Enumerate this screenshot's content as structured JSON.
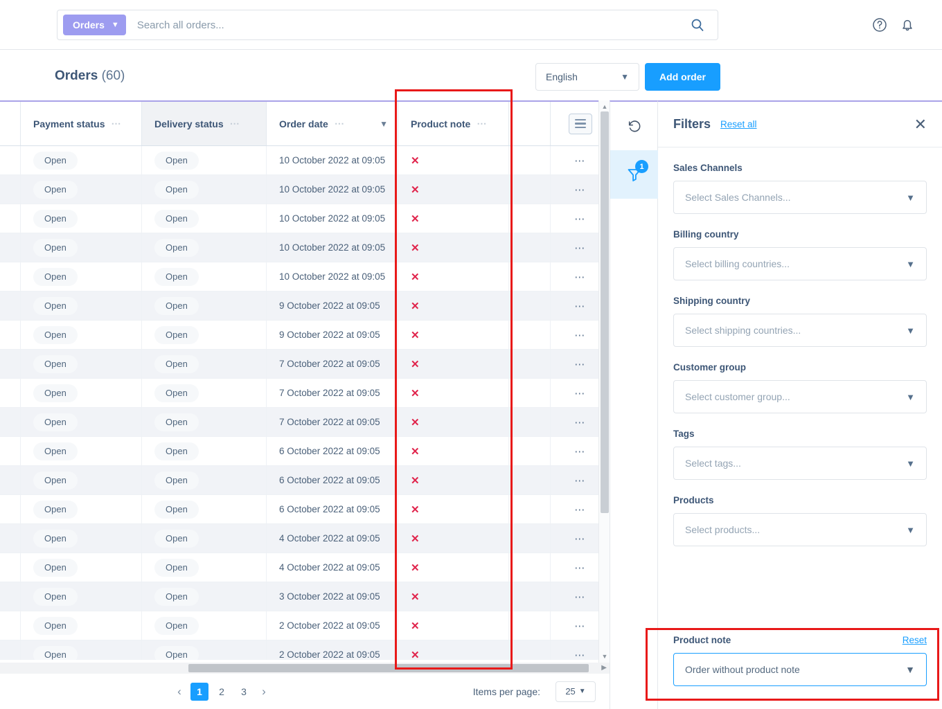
{
  "topbar": {
    "scope_label": "Orders",
    "scope_chevron": "chevron-down-icon",
    "search_placeholder": "Search all orders...",
    "search_value": "",
    "help_icon": "question-circle-icon",
    "bell_icon": "bell-icon"
  },
  "header": {
    "title": "Orders",
    "count": "(60)",
    "language": "English",
    "add_order_label": "Add order"
  },
  "table": {
    "columns": [
      {
        "label": "Payment status",
        "menu": "⋯",
        "sortable": false
      },
      {
        "label": "Delivery status",
        "menu": "⋯",
        "sortable": false
      },
      {
        "label": "Order date",
        "menu": "⋯",
        "sortable": true
      },
      {
        "label": "Product note",
        "menu": "⋯",
        "sortable": false
      }
    ],
    "settings_icon": "list-settings-icon",
    "row_action_icon": "ellipsis-icon",
    "note_icon": "x-mark-icon",
    "rows": [
      {
        "payment_status": "Open",
        "delivery_status": "Open",
        "order_date": "10 October 2022 at 09:05",
        "product_note": "✕"
      },
      {
        "payment_status": "Open",
        "delivery_status": "Open",
        "order_date": "10 October 2022 at 09:05",
        "product_note": "✕"
      },
      {
        "payment_status": "Open",
        "delivery_status": "Open",
        "order_date": "10 October 2022 at 09:05",
        "product_note": "✕"
      },
      {
        "payment_status": "Open",
        "delivery_status": "Open",
        "order_date": "10 October 2022 at 09:05",
        "product_note": "✕"
      },
      {
        "payment_status": "Open",
        "delivery_status": "Open",
        "order_date": "10 October 2022 at 09:05",
        "product_note": "✕"
      },
      {
        "payment_status": "Open",
        "delivery_status": "Open",
        "order_date": "9 October 2022 at 09:05",
        "product_note": "✕"
      },
      {
        "payment_status": "Open",
        "delivery_status": "Open",
        "order_date": "9 October 2022 at 09:05",
        "product_note": "✕"
      },
      {
        "payment_status": "Open",
        "delivery_status": "Open",
        "order_date": "7 October 2022 at 09:05",
        "product_note": "✕"
      },
      {
        "payment_status": "Open",
        "delivery_status": "Open",
        "order_date": "7 October 2022 at 09:05",
        "product_note": "✕"
      },
      {
        "payment_status": "Open",
        "delivery_status": "Open",
        "order_date": "7 October 2022 at 09:05",
        "product_note": "✕"
      },
      {
        "payment_status": "Open",
        "delivery_status": "Open",
        "order_date": "6 October 2022 at 09:05",
        "product_note": "✕"
      },
      {
        "payment_status": "Open",
        "delivery_status": "Open",
        "order_date": "6 October 2022 at 09:05",
        "product_note": "✕"
      },
      {
        "payment_status": "Open",
        "delivery_status": "Open",
        "order_date": "6 October 2022 at 09:05",
        "product_note": "✕"
      },
      {
        "payment_status": "Open",
        "delivery_status": "Open",
        "order_date": "4 October 2022 at 09:05",
        "product_note": "✕"
      },
      {
        "payment_status": "Open",
        "delivery_status": "Open",
        "order_date": "4 October 2022 at 09:05",
        "product_note": "✕"
      },
      {
        "payment_status": "Open",
        "delivery_status": "Open",
        "order_date": "3 October 2022 at 09:05",
        "product_note": "✕"
      },
      {
        "payment_status": "Open",
        "delivery_status": "Open",
        "order_date": "2 October 2022 at 09:05",
        "product_note": "✕"
      },
      {
        "payment_status": "Open",
        "delivery_status": "Open",
        "order_date": "2 October 2022 at 09:05",
        "product_note": "✕"
      }
    ]
  },
  "pagination": {
    "prev": "‹",
    "next": "›",
    "pages": [
      "1",
      "2",
      "3"
    ],
    "active_page": "1",
    "items_per_page_label": "Items per page:",
    "items_per_page_value": "25"
  },
  "rail": {
    "undo_icon": "undo-icon",
    "filter_icon": "filter-icon",
    "filter_badge": "1"
  },
  "filters": {
    "title": "Filters",
    "reset_all": "Reset all",
    "close_icon": "close-icon",
    "groups": [
      {
        "label": "Sales Channels",
        "placeholder": "Select Sales Channels..."
      },
      {
        "label": "Billing country",
        "placeholder": "Select billing countries..."
      },
      {
        "label": "Shipping country",
        "placeholder": "Select shipping countries..."
      },
      {
        "label": "Customer group",
        "placeholder": "Select customer group..."
      },
      {
        "label": "Tags",
        "placeholder": "Select tags..."
      },
      {
        "label": "Products",
        "placeholder": "Select products..."
      }
    ],
    "product_note": {
      "label": "Product note",
      "reset": "Reset",
      "value": "Order without product note"
    }
  },
  "colors": {
    "accent_blue": "#189eff",
    "scope_purple": "#9d9cf0",
    "top_border_purple": "#a9a2e8",
    "x_mark_red": "#e0234b",
    "annotation_red": "#e81919"
  }
}
